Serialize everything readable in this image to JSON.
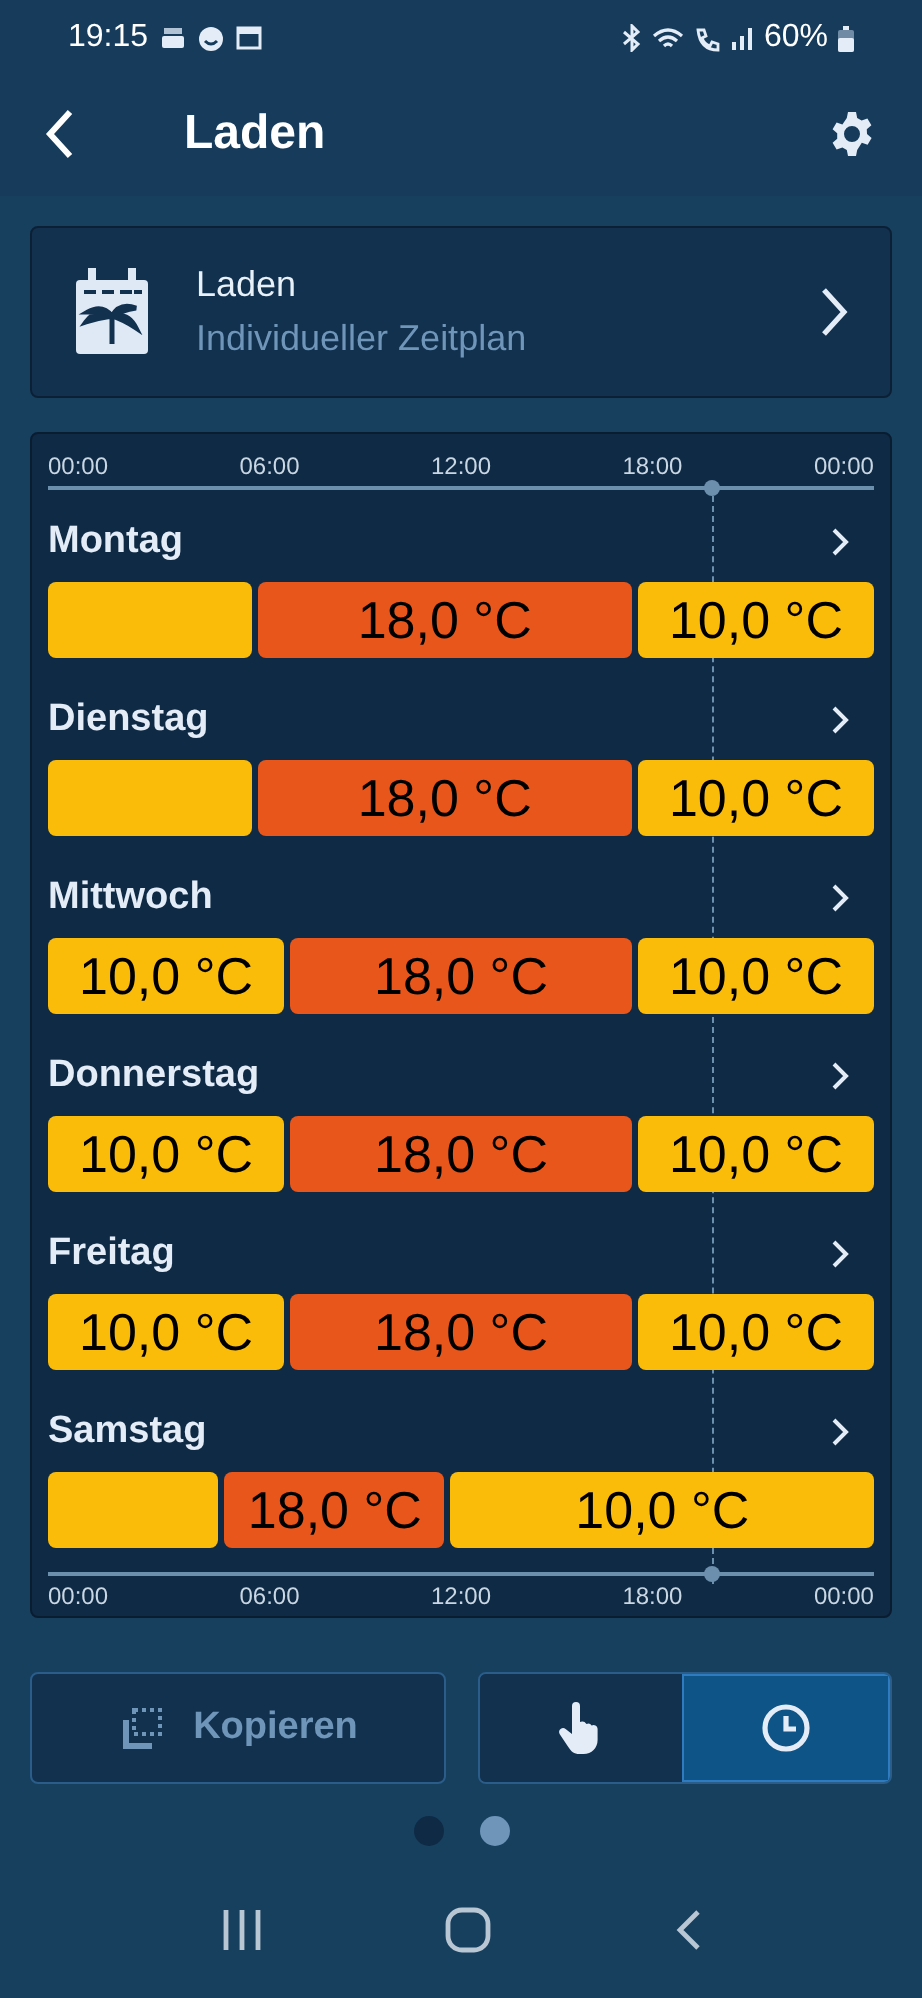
{
  "status_bar": {
    "time": "19:15",
    "battery": "60%"
  },
  "header": {
    "title": "Laden"
  },
  "profile_card": {
    "title": "Laden",
    "subtitle": "Individueller Zeitplan"
  },
  "schedule": {
    "top_axis_labels": [
      "00:00",
      "06:00",
      "12:00",
      "18:00",
      "00:00"
    ],
    "bottom_axis_labels": [
      "00:00",
      "06:00",
      "12:00",
      "18:00",
      "00:00"
    ],
    "time_marker": {
      "level": 0.805
    },
    "days": [
      {
        "name": "Montag",
        "segments": [
          {
            "color": "#fbbc09"
          },
          {
            "color": "#e8561b",
            "label": "18,0 °C"
          },
          {
            "color": "#fbbc09",
            "label": "10,0 °C"
          }
        ]
      },
      {
        "name": "Dienstag",
        "segments": [
          {
            "color": "#fbbc09"
          },
          {
            "color": "#e8561b",
            "label": "18,0 °C"
          },
          {
            "color": "#fbbc09",
            "label": "10,0 °C"
          }
        ]
      },
      {
        "name": "Mittwoch",
        "segments": [
          {
            "color": "#fbbc09",
            "label": "10,0 °C"
          },
          {
            "color": "#e8561b",
            "label": "18,0 °C"
          },
          {
            "color": "#fbbc09",
            "label": "10,0 °C"
          }
        ]
      },
      {
        "name": "Donnerstag",
        "segments": [
          {
            "color": "#fbbc09",
            "label": "10,0 °C"
          },
          {
            "color": "#e8561b",
            "label": "18,0 °C"
          },
          {
            "color": "#fbbc09",
            "label": "10,0 °C"
          }
        ]
      },
      {
        "name": "Freitag",
        "segments": [
          {
            "color": "#fbbc09",
            "label": "10,0 °C"
          },
          {
            "color": "#e8561b",
            "label": "18,0 °C"
          },
          {
            "color": "#fbbc09",
            "label": "10,0 °C"
          }
        ]
      },
      {
        "name": "Samstag",
        "segments": [
          {
            "color": "#fbbc09"
          },
          {
            "color": "#e8561b",
            "label": "18,0 °C"
          },
          {
            "color": "#fbbc09",
            "label": "10,0 °C"
          }
        ]
      }
    ]
  },
  "copy_button": {
    "label": "Kopieren"
  },
  "modes": [
    {
      "kind": "manual",
      "selected": false
    },
    {
      "kind": "schedule",
      "selected": true
    }
  ],
  "pager": [
    {
      "selected": false
    },
    {
      "selected": true
    }
  ]
}
